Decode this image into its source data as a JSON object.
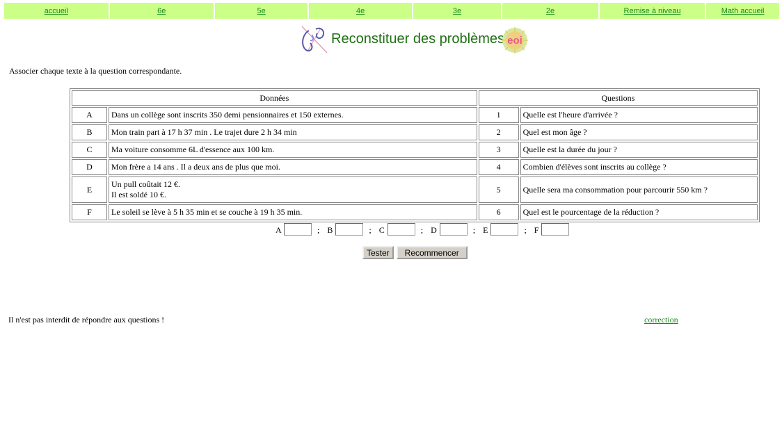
{
  "nav": [
    "accueil",
    "6e",
    "5e",
    "4e",
    "3e",
    "2e",
    "Remise à niveau",
    "Math accueil"
  ],
  "header": {
    "title": "Reconstituer des problèmes",
    "logo_text": "eoi"
  },
  "instruction": "Associer chaque texte à la question correspondante.",
  "table": {
    "headers": [
      "Données",
      "Questions"
    ],
    "rows": [
      {
        "letter": "A",
        "text": "Dans un collège sont inscrits 350 demi pensionnaires et 150 externes.",
        "text2": "",
        "num": "1",
        "question": "Quelle est l'heure d'arrivée ?"
      },
      {
        "letter": "B",
        "text": "Mon train part à 17 h 37 min . Le trajet dure 2 h 34 min",
        "text2": "",
        "num": "2",
        "question": "Quel est mon âge ?"
      },
      {
        "letter": "C",
        "text": "Ma voiture consomme 6L d'essence aux 100 km.",
        "text2": "",
        "num": "3",
        "question": "Quelle est la durée du jour ?"
      },
      {
        "letter": "D",
        "text": "Mon frère a 14 ans . Il a deux ans de plus que moi.",
        "text2": "",
        "num": "4",
        "question": "Combien d'élèves sont inscrits au collège ?"
      },
      {
        "letter": "E",
        "text": "Un pull coûtait 12 €.",
        "text2": "Il est soldé 10 €.",
        "num": "5",
        "question": "Quelle sera ma consommation pour parcourir 550 km ?"
      },
      {
        "letter": "F",
        "text": "Le soleil se lève à 5 h 35 min et se couche à 19 h 35 min.",
        "text2": "",
        "num": "6",
        "question": "Quel est le pourcentage de la réduction ?"
      }
    ]
  },
  "answers": {
    "labels": [
      "A",
      "B",
      "C",
      "D",
      "E",
      "F"
    ],
    "separator": ";",
    "values": [
      "",
      "",
      "",
      "",
      "",
      ""
    ]
  },
  "buttons": {
    "test": "Tester",
    "reset": "Recommencer"
  },
  "footer": {
    "note": "Il n'est pas interdit de répondre aux questions !",
    "correction": "correction"
  },
  "colors": {
    "nav_bg": "#ccff88",
    "link": "#1a8a1a",
    "title": "#1e6e12"
  }
}
